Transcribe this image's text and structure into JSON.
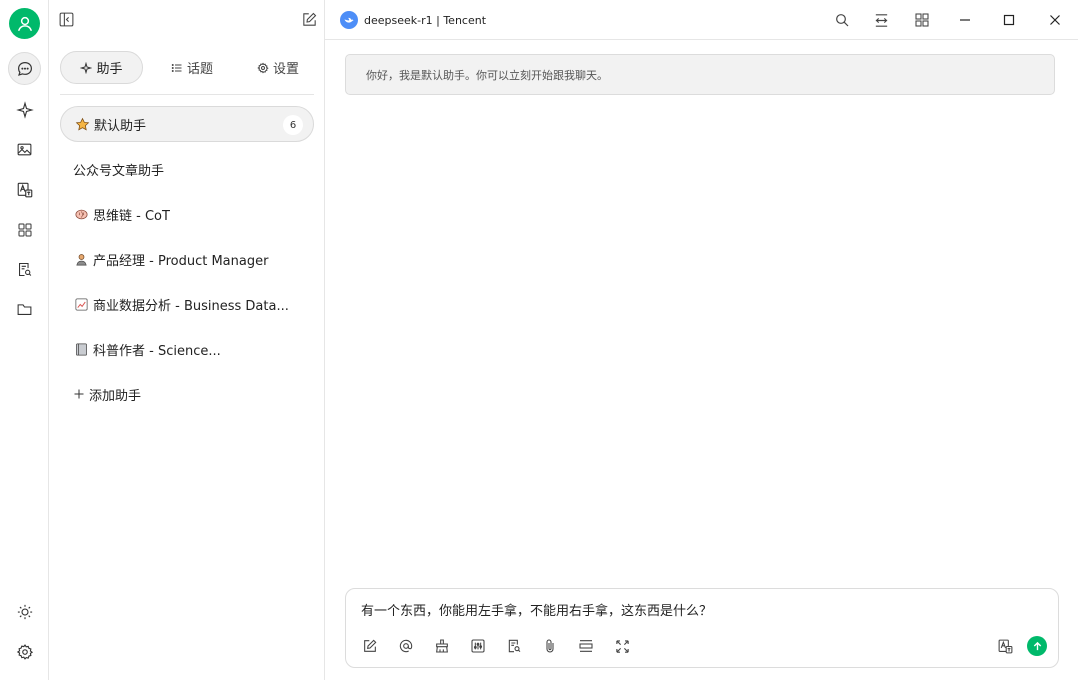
{
  "sidebar": {
    "tabs": [
      {
        "label": "助手",
        "icon": "sparkle-icon",
        "active": true
      },
      {
        "label": "话题",
        "icon": "list-icon",
        "active": false
      },
      {
        "label": "设置",
        "icon": "gear-icon",
        "active": false
      }
    ],
    "assistants": [
      {
        "label": "默认助手",
        "emoji": "star-icon",
        "count": "6",
        "active": true
      },
      {
        "label": "公众号文章助手",
        "emoji": "",
        "active": false
      },
      {
        "label": "思维链 - CoT",
        "emoji": "brain-icon",
        "active": false
      },
      {
        "label": "产品经理 - Product Manager",
        "emoji": "person-icon",
        "active": false
      },
      {
        "label": "商业数据分析 - Business Data...",
        "emoji": "chart-icon",
        "active": false
      },
      {
        "label": "科普作者 - Science...",
        "emoji": "book-icon",
        "active": false
      }
    ],
    "add_label": "添加助手"
  },
  "header": {
    "model": "deepseek-r1 | Tencent"
  },
  "chat": {
    "welcome": "你好，我是默认助手。你可以立刻开始跟我聊天。",
    "input_value": "有一个东西，你能用左手拿，不能用右手拿，这东西是什么？"
  },
  "colors": {
    "accent": "#00b96b",
    "model_logo": "#4d8ef7"
  }
}
